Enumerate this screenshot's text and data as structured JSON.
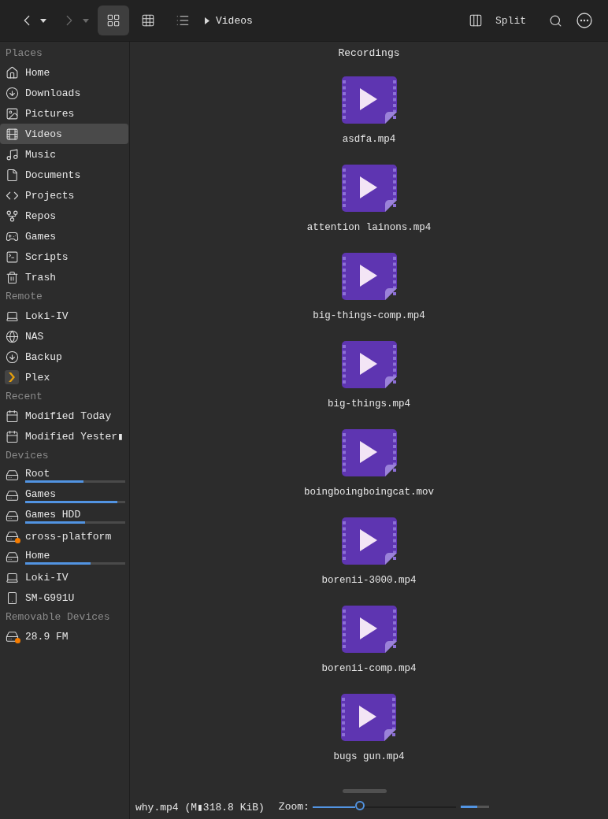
{
  "toolbar": {
    "back": {
      "disabled": false
    },
    "forward": {
      "disabled": true
    },
    "views": [
      {
        "selected": true
      },
      {
        "selected": false
      },
      {
        "selected": false
      }
    ],
    "path": "Videos",
    "split_label": "Split"
  },
  "sidebar": [
    {
      "header": "Places",
      "items": [
        {
          "label": "Home",
          "selected": false
        },
        {
          "label": "Downloads",
          "selected": false
        },
        {
          "label": "Pictures",
          "selected": false
        },
        {
          "label": "Videos",
          "selected": true
        },
        {
          "label": "Music",
          "selected": false
        },
        {
          "label": "Documents",
          "selected": false
        },
        {
          "label": "Projects",
          "selected": false
        },
        {
          "label": "Repos",
          "selected": false
        },
        {
          "label": "Games",
          "selected": false
        },
        {
          "label": "Scripts",
          "selected": false
        },
        {
          "label": "Trash",
          "selected": false
        }
      ]
    },
    {
      "header": "Remote",
      "items": [
        {
          "label": "Loki-IV",
          "selected": false
        },
        {
          "label": "NAS",
          "selected": false
        },
        {
          "label": "Backup",
          "selected": false
        },
        {
          "label": "Plex",
          "selected": false
        }
      ]
    },
    {
      "header": "Recent",
      "items": [
        {
          "label": "Modified Today",
          "selected": false
        },
        {
          "label": "Modified Yester▮",
          "selected": false
        }
      ]
    },
    {
      "header": "Devices",
      "items": [
        {
          "label": "Root",
          "selected": false,
          "level": 0.58
        },
        {
          "label": "Games",
          "selected": false,
          "level": 0.92
        },
        {
          "label": "Games HDD",
          "selected": false,
          "level": 0.6
        },
        {
          "label": "cross-platform",
          "selected": false
        },
        {
          "label": "Home",
          "selected": false,
          "level": 0.65
        },
        {
          "label": "Loki-IV",
          "selected": false
        },
        {
          "label": "SM-G991U",
          "selected": false
        }
      ]
    },
    {
      "header": "Removable Devices",
      "items": [
        {
          "label": "28.9 FM",
          "selected": false
        }
      ]
    }
  ],
  "content": {
    "group_title": "Recordings",
    "files": [
      {
        "name": "asdfa.mp4"
      },
      {
        "name": "attention lainons.mp4"
      },
      {
        "name": "big-things-comp.mp4"
      },
      {
        "name": "big-things.mp4"
      },
      {
        "name": "boingboingboingcat.mov"
      },
      {
        "name": "borenii-3000.mp4"
      },
      {
        "name": "borenii-comp.mp4"
      },
      {
        "name": "bugs gun.mp4"
      }
    ]
  },
  "status_bar": {
    "selection": "why.mp4 (M▮318.8 KiB)",
    "zoom_label": "Zoom:",
    "zoom": {
      "level": 0.34
    },
    "meter": {
      "level": 0.6
    }
  }
}
